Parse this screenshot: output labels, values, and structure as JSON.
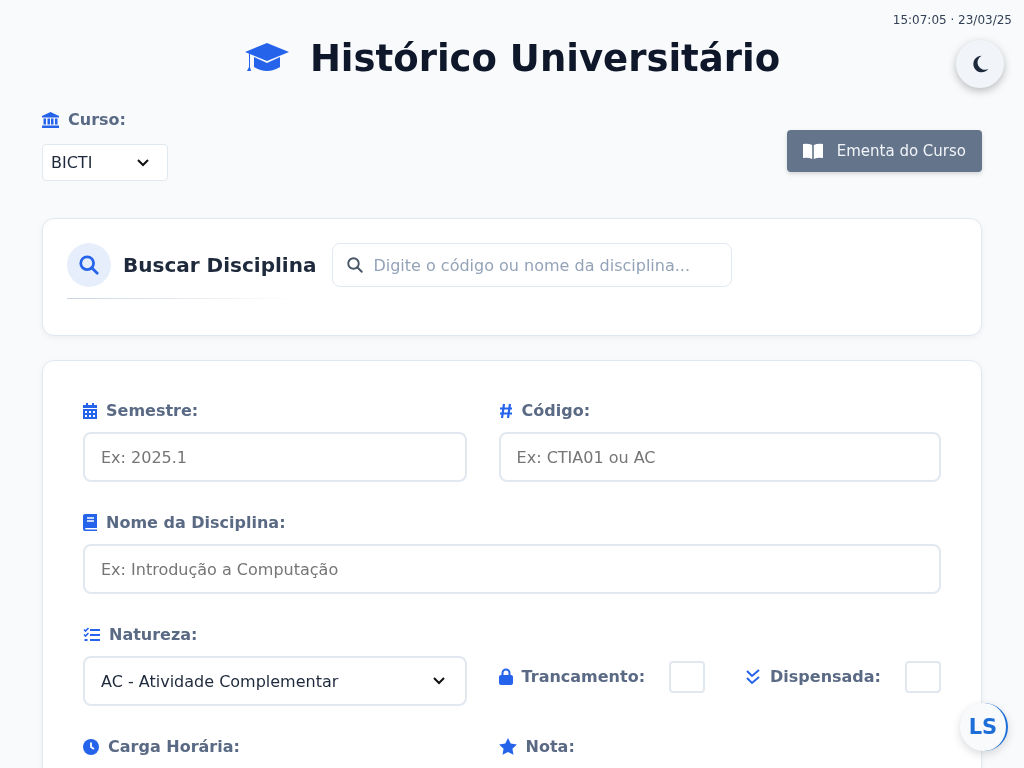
{
  "timestamp": "15:07:05 · 23/03/25",
  "title": "Histórico Universitário",
  "course": {
    "label": "Curso:",
    "value": "BICTI"
  },
  "syllabus_button": "Ementa do Curso",
  "search": {
    "title": "Buscar Disciplina",
    "placeholder": "Digite o código ou nome da disciplina..."
  },
  "semester": {
    "label": "Semestre:",
    "placeholder": "Ex: 2025.1"
  },
  "code": {
    "label": "Código:",
    "placeholder": "Ex: CTIA01 ou AC"
  },
  "name": {
    "label": "Nome da Disciplina:",
    "placeholder": "Ex: Introdução a Computação"
  },
  "nature": {
    "label": "Natureza:",
    "value": "AC - Atividade Complementar"
  },
  "locked": {
    "label": "Trancamento:",
    "checked": false
  },
  "waived": {
    "label": "Dispensada:",
    "checked": false
  },
  "workload": {
    "label": "Carga Horária:"
  },
  "grade": {
    "label": "Nota:"
  },
  "avatar": "LS"
}
